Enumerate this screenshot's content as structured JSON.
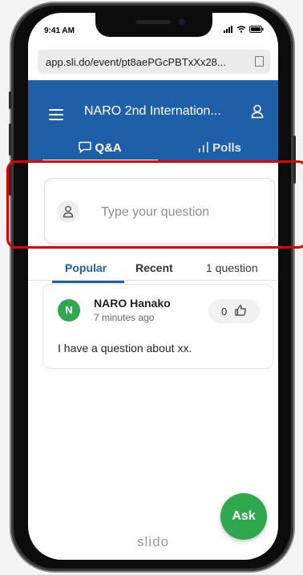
{
  "status": {
    "time": "9:41 AM"
  },
  "browser": {
    "url": "app.sli.do/event/pt8aePGcPBTxXx28..."
  },
  "header": {
    "event_title": "NARO 2nd Internation...",
    "tabs": [
      {
        "label": "Q&A",
        "active": true
      },
      {
        "label": "Polls",
        "active": false
      }
    ]
  },
  "ask_card": {
    "placeholder": "Type your question"
  },
  "filters": {
    "popular": "Popular",
    "recent": "Recent",
    "count": "1 question"
  },
  "questions": [
    {
      "author_initial": "N",
      "author": "NARO Hanako",
      "time": "7 minutes ago",
      "likes": "0",
      "text": "I have a question about xx."
    }
  ],
  "footer": {
    "brand": "slido",
    "ask_label": "Ask"
  },
  "colors": {
    "primary": "#1e5fa8",
    "accent_green": "#2fa84f",
    "highlight_red": "#e00000"
  },
  "icons": [
    "menu-icon",
    "user-icon",
    "speech-bubble-icon",
    "bar-chart-icon",
    "copy-icon",
    "thumbs-up-icon",
    "signal-icon",
    "wifi-icon",
    "battery-icon"
  ]
}
